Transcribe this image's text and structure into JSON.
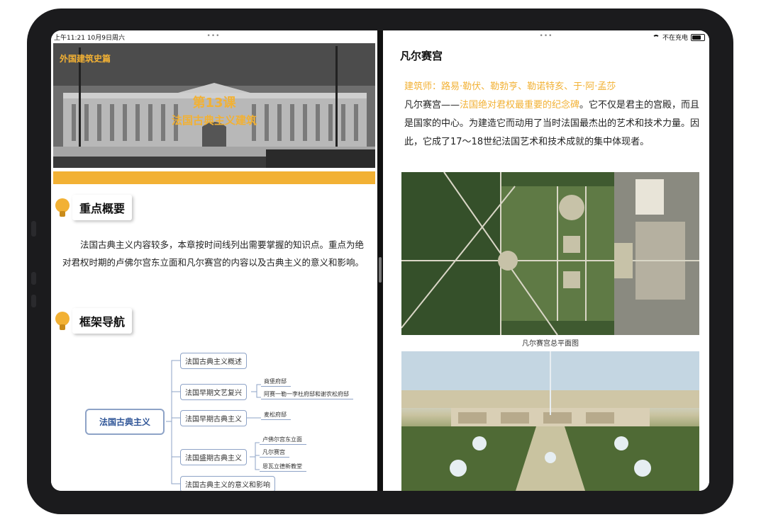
{
  "status_bar": {
    "time": "上午11:21",
    "date": "10月9日周六",
    "charging": "不在充电"
  },
  "left": {
    "hero": {
      "series_tag": "外国建筑史篇",
      "lesson": "第13课",
      "title": "法国古典主义建筑"
    },
    "overview": {
      "heading": "重点概要",
      "text": "法国古典主义内容较多，本章按时间线列出需要掌握的知识点。重点为绝对君权时期的卢佛尔宫东立面和凡尔赛宫的内容以及古典主义的意义和影响。"
    },
    "navigation": {
      "heading": "框架导航",
      "root": "法国古典主义",
      "branches": [
        {
          "label": "法国古典主义概述",
          "leaves": []
        },
        {
          "label": "法国早期文艺复兴",
          "leaves": [
            "商堡府邸",
            "阿赛一勒一李杜府邸和谢农松府邸"
          ]
        },
        {
          "label": "法国早期古典主义",
          "leaves": [
            "麦松府邸"
          ]
        },
        {
          "label": "法国盛期古典主义",
          "leaves": [
            "卢佛尔宫东立面",
            "凡尔赛宫",
            "恩瓦立德新教堂"
          ]
        },
        {
          "label": "法国古典主义的意义和影响",
          "leaves": []
        }
      ]
    }
  },
  "right": {
    "title": "凡尔赛宫",
    "architects": "建筑师：路易·勒伏、勒勃亨、勒诺特亥、于·阿·孟莎",
    "text_start": "凡尔赛宫——",
    "text_highlight": "法国绝对君权最重要的纪念碑",
    "text_rest": "。它不仅是君主的宫殿，而且是国家的中心。为建造它而动用了当时法国最杰出的艺术和技术力量。因此，它成了17～18世纪法国艺术和技术成就的集中体现者。",
    "map_caption": "凡尔赛宫总平面图"
  }
}
